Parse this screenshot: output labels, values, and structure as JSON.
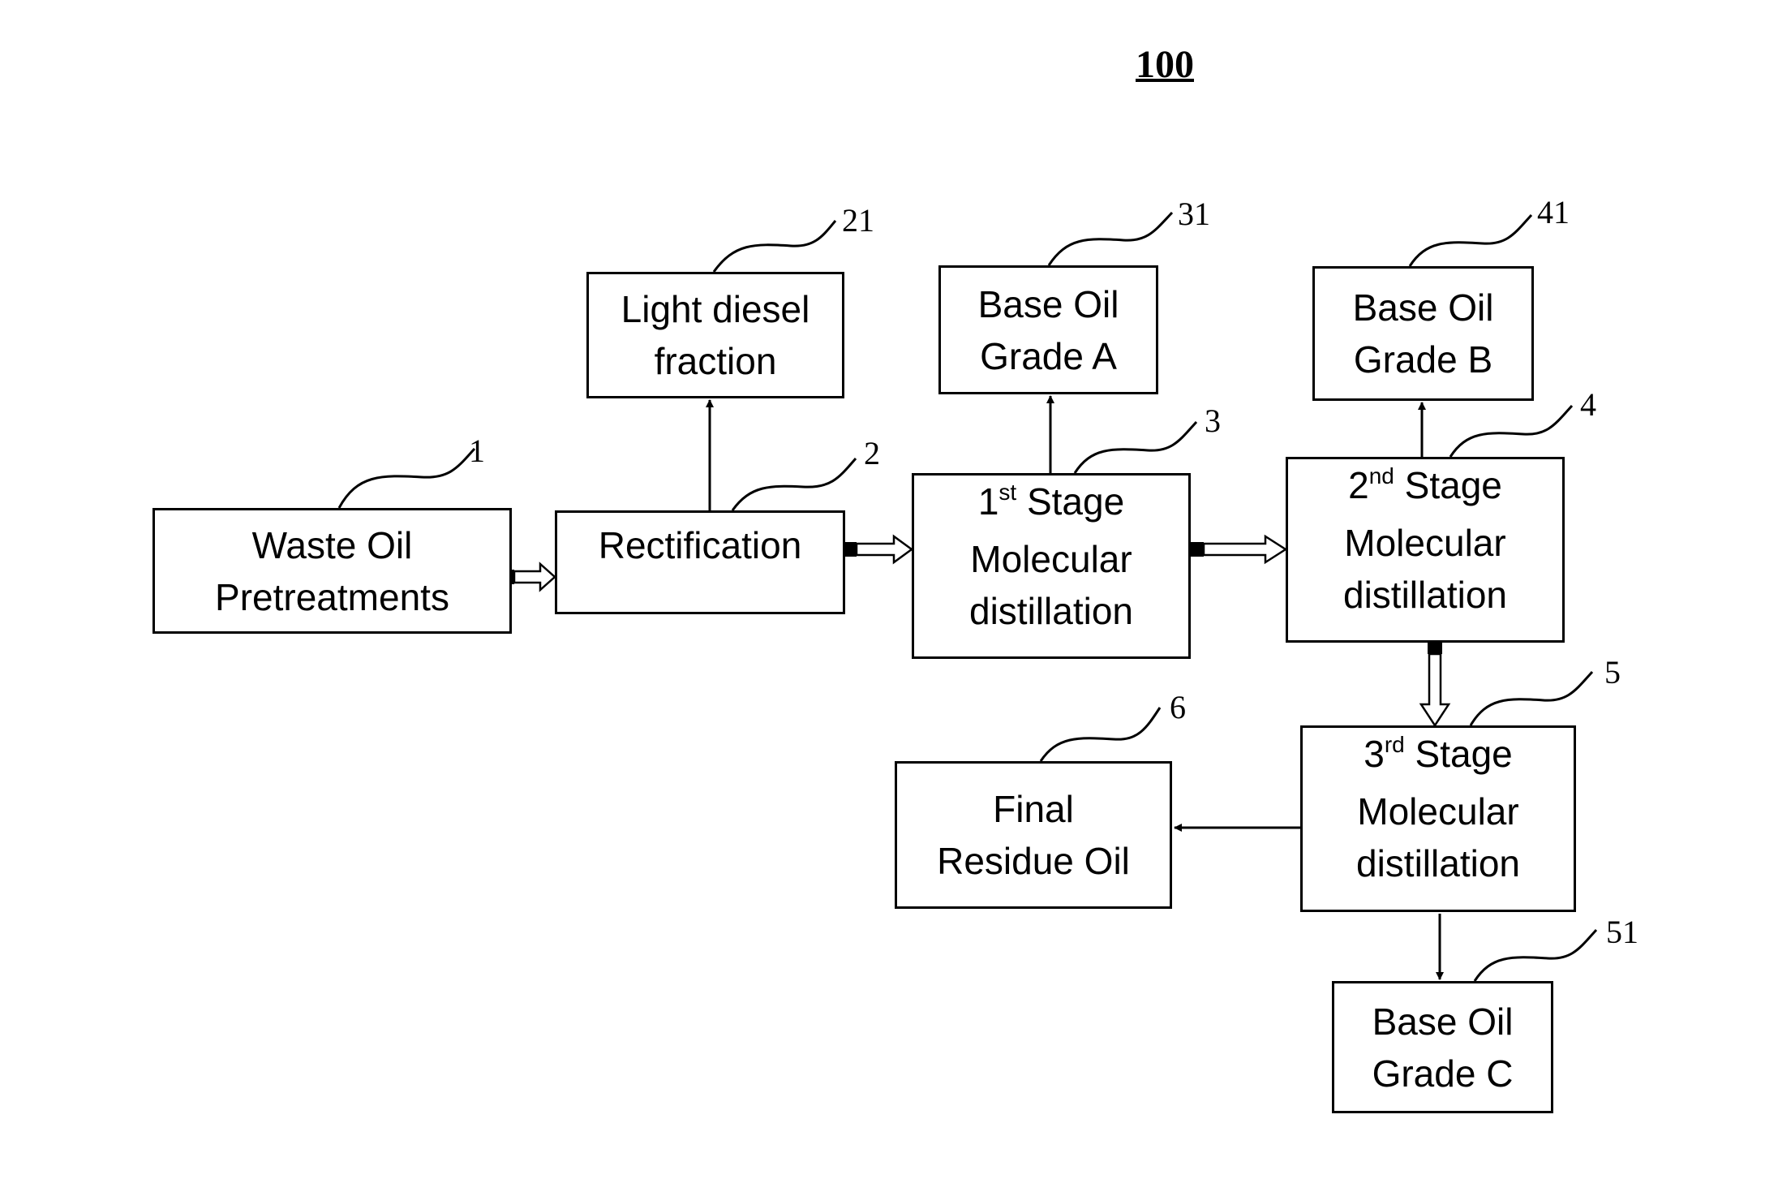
{
  "figure": {
    "number": "100"
  },
  "nodes": {
    "pretreatment": {
      "ref": "1",
      "line1": "Waste Oil",
      "line2": "Pretreatments"
    },
    "rectification": {
      "ref": "2",
      "line1": "Rectification"
    },
    "light_diesel": {
      "ref": "21",
      "line1": "Light diesel",
      "line2": "fraction"
    },
    "stage1": {
      "ref": "3",
      "ordinal": "1",
      "suffix": "st",
      "word": "Stage",
      "line2": "Molecular",
      "line3": "distillation"
    },
    "grade_a": {
      "ref": "31",
      "line1": "Base Oil",
      "line2": "Grade A"
    },
    "stage2": {
      "ref": "4",
      "ordinal": "2",
      "suffix": "nd",
      "word": "Stage",
      "line2": "Molecular",
      "line3": "distillation"
    },
    "grade_b": {
      "ref": "41",
      "line1": "Base Oil",
      "line2": "Grade B"
    },
    "stage3": {
      "ref": "5",
      "ordinal": "3",
      "suffix": "rd",
      "word": "Stage",
      "line2": "Molecular",
      "line3": "distillation"
    },
    "residue": {
      "ref": "6",
      "line1": "Final",
      "line2": "Residue Oil"
    },
    "grade_c": {
      "ref": "51",
      "line1": "Base Oil",
      "line2": "Grade C"
    }
  },
  "edges": [
    {
      "from": "pretreatment",
      "to": "rectification",
      "style": "hollow-block"
    },
    {
      "from": "rectification",
      "to": "light_diesel",
      "style": "line"
    },
    {
      "from": "rectification",
      "to": "stage1",
      "style": "hollow-block"
    },
    {
      "from": "stage1",
      "to": "grade_a",
      "style": "line"
    },
    {
      "from": "stage1",
      "to": "stage2",
      "style": "hollow-block"
    },
    {
      "from": "stage2",
      "to": "grade_b",
      "style": "line"
    },
    {
      "from": "stage2",
      "to": "stage3",
      "style": "hollow-block"
    },
    {
      "from": "stage3",
      "to": "residue",
      "style": "line"
    },
    {
      "from": "stage3",
      "to": "grade_c",
      "style": "line"
    }
  ]
}
